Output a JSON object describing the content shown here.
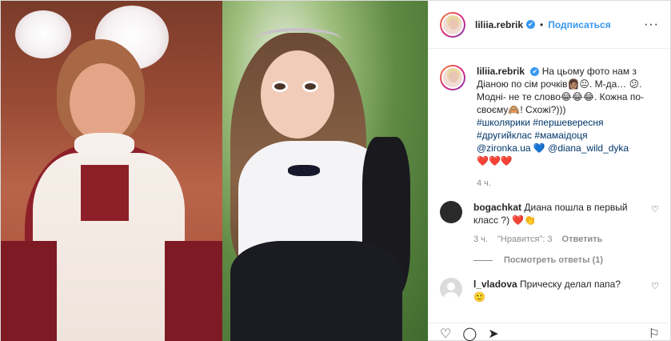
{
  "header": {
    "username": "liliia.rebrik",
    "verified_mark": "✔",
    "separator": "•",
    "follow_label": "Подписаться",
    "more_label": "···"
  },
  "caption": {
    "username": "liliia.rebrik",
    "text_line1": "На цьому фото нам з Діаною по сім рочків",
    "emoji1": "👩🏽😐",
    "text_line2": ". М-да…",
    "emoji2": "😕",
    "text_line3": ". Модні- не те слово",
    "emoji3": "😂😂😂",
    "text_line4": ". Кожна по-своєму",
    "emoji4": "🙈",
    "text_line5": "! Схожі?)))",
    "hashtags1": "#школярики #першевересня",
    "hashtags2": "#другийклас #мамаідоця",
    "mention1": "@zironka.ua",
    "mention_heart": "💙",
    "mention2": "@diana_wild_dyka",
    "hearts": "❤️❤️❤️",
    "time": "4 ч."
  },
  "comments": [
    {
      "username": "bogachkat",
      "text": "Диана пошла в первый класс ?)",
      "emoji": "❤️👏",
      "time": "3 ч.",
      "likes": "\"Нравится\": 3",
      "reply": "Ответить",
      "view_replies": "Посмотреть ответы (1)",
      "like_icon": "♡"
    },
    {
      "username": "l_vladova",
      "text": "Прическу делал папа?",
      "emoji": "🙂",
      "like_icon": "♡"
    }
  ],
  "actions": {
    "like_icon": "♡",
    "comment_icon": "◯",
    "share_icon": "➤",
    "save_icon": "⚐"
  }
}
